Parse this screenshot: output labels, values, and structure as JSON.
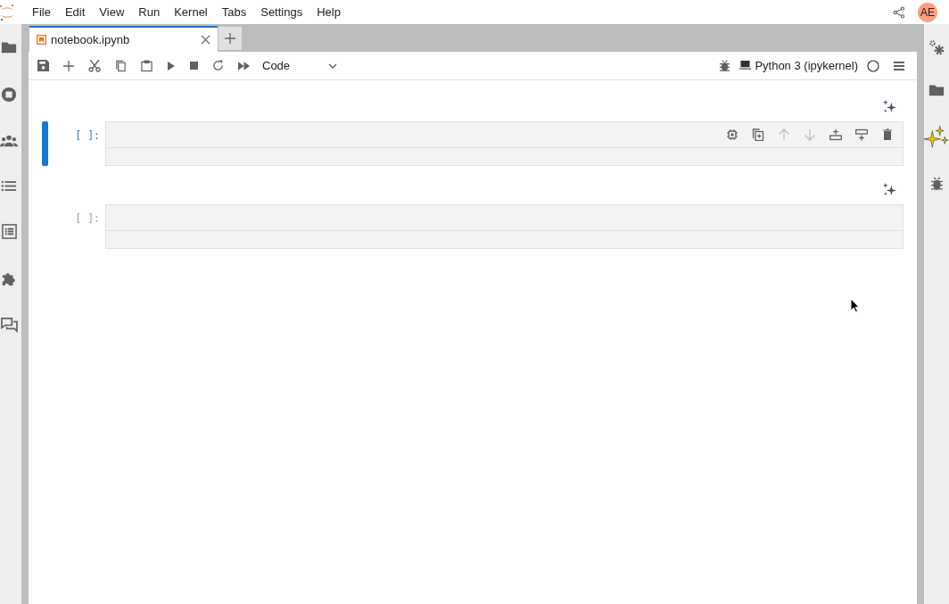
{
  "menu": [
    "File",
    "Edit",
    "View",
    "Run",
    "Kernel",
    "Tabs",
    "Settings",
    "Help"
  ],
  "user": {
    "initials": "AE"
  },
  "tab": {
    "title": "notebook.ipynb"
  },
  "toolbar": {
    "cell_type": "Code",
    "kernel": "Python 3 (ipykernel)"
  },
  "cell_toolbar": [
    {
      "kind": "chip",
      "disabled": false
    },
    {
      "kind": "duplicate",
      "disabled": false
    },
    {
      "kind": "up",
      "disabled": true
    },
    {
      "kind": "down",
      "disabled": true
    },
    {
      "kind": "insert-above",
      "disabled": false
    },
    {
      "kind": "insert-below",
      "disabled": false
    },
    {
      "kind": "delete",
      "disabled": false
    }
  ],
  "cells": [
    {
      "prompt": "[ ]:",
      "selected": true
    },
    {
      "prompt": "[ ]:",
      "selected": false
    }
  ]
}
